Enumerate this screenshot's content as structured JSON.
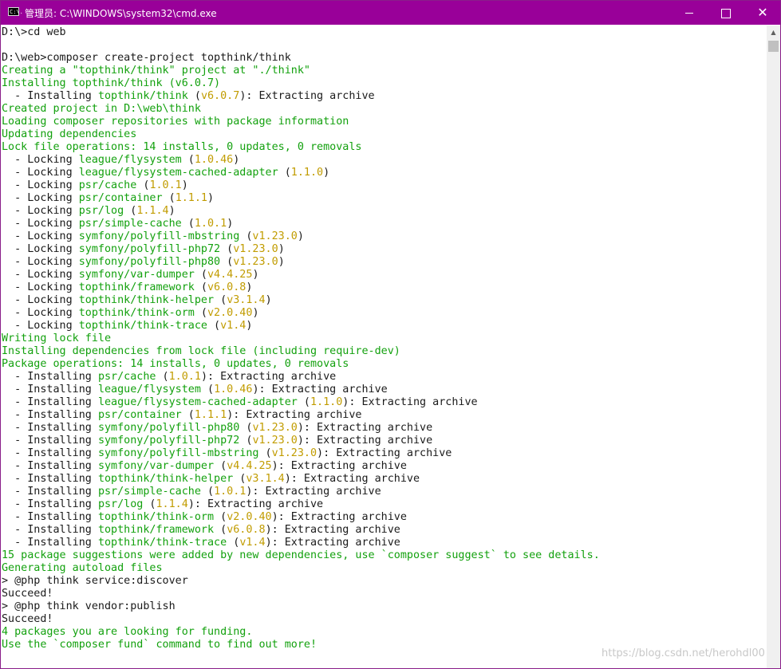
{
  "window": {
    "title": "管理员: C:\\WINDOWS\\system32\\cmd.exe",
    "icon": "console-icon",
    "icon_text": "C:\\.",
    "controls": {
      "minimize": "minimize-icon",
      "maximize": "maximize-icon",
      "close": "close-icon",
      "close_glyph": "✕"
    }
  },
  "colors": {
    "titlebar": "#990099",
    "green": "#13a10e",
    "yellow": "#c19c00",
    "text": "#1a1a1a"
  },
  "scrollbar": {
    "up_arrow": "▲"
  },
  "watermark": "https://blog.csdn.net/herohdl00",
  "lines": [
    [
      {
        "t": "D:\\>cd web",
        "c": "w"
      }
    ],
    [],
    [
      {
        "t": "D:\\web>composer create-project topthink/think",
        "c": "w"
      }
    ],
    [
      {
        "t": "Creating a \"topthink/think\" project at \"./think\"",
        "c": "g"
      }
    ],
    [
      {
        "t": "Installing topthink/think (v6.0.7)",
        "c": "g"
      }
    ],
    [
      {
        "t": "  - Installing ",
        "c": "w"
      },
      {
        "t": "topthink/think",
        "c": "g"
      },
      {
        "t": " (",
        "c": "w"
      },
      {
        "t": "v6.0.7",
        "c": "y"
      },
      {
        "t": "): Extracting archive",
        "c": "w"
      }
    ],
    [
      {
        "t": "Created project in D:\\web\\think",
        "c": "g"
      }
    ],
    [
      {
        "t": "Loading composer repositories with package information",
        "c": "g"
      }
    ],
    [
      {
        "t": "Updating dependencies",
        "c": "g"
      }
    ],
    [
      {
        "t": "Lock file operations: 14 installs, 0 updates, 0 removals",
        "c": "g"
      }
    ],
    [
      {
        "t": "  - Locking ",
        "c": "w"
      },
      {
        "t": "league/flysystem",
        "c": "g"
      },
      {
        "t": " (",
        "c": "w"
      },
      {
        "t": "1.0.46",
        "c": "y"
      },
      {
        "t": ")",
        "c": "w"
      }
    ],
    [
      {
        "t": "  - Locking ",
        "c": "w"
      },
      {
        "t": "league/flysystem-cached-adapter",
        "c": "g"
      },
      {
        "t": " (",
        "c": "w"
      },
      {
        "t": "1.1.0",
        "c": "y"
      },
      {
        "t": ")",
        "c": "w"
      }
    ],
    [
      {
        "t": "  - Locking ",
        "c": "w"
      },
      {
        "t": "psr/cache",
        "c": "g"
      },
      {
        "t": " (",
        "c": "w"
      },
      {
        "t": "1.0.1",
        "c": "y"
      },
      {
        "t": ")",
        "c": "w"
      }
    ],
    [
      {
        "t": "  - Locking ",
        "c": "w"
      },
      {
        "t": "psr/container",
        "c": "g"
      },
      {
        "t": " (",
        "c": "w"
      },
      {
        "t": "1.1.1",
        "c": "y"
      },
      {
        "t": ")",
        "c": "w"
      }
    ],
    [
      {
        "t": "  - Locking ",
        "c": "w"
      },
      {
        "t": "psr/log",
        "c": "g"
      },
      {
        "t": " (",
        "c": "w"
      },
      {
        "t": "1.1.4",
        "c": "y"
      },
      {
        "t": ")",
        "c": "w"
      }
    ],
    [
      {
        "t": "  - Locking ",
        "c": "w"
      },
      {
        "t": "psr/simple-cache",
        "c": "g"
      },
      {
        "t": " (",
        "c": "w"
      },
      {
        "t": "1.0.1",
        "c": "y"
      },
      {
        "t": ")",
        "c": "w"
      }
    ],
    [
      {
        "t": "  - Locking ",
        "c": "w"
      },
      {
        "t": "symfony/polyfill-mbstring",
        "c": "g"
      },
      {
        "t": " (",
        "c": "w"
      },
      {
        "t": "v1.23.0",
        "c": "y"
      },
      {
        "t": ")",
        "c": "w"
      }
    ],
    [
      {
        "t": "  - Locking ",
        "c": "w"
      },
      {
        "t": "symfony/polyfill-php72",
        "c": "g"
      },
      {
        "t": " (",
        "c": "w"
      },
      {
        "t": "v1.23.0",
        "c": "y"
      },
      {
        "t": ")",
        "c": "w"
      }
    ],
    [
      {
        "t": "  - Locking ",
        "c": "w"
      },
      {
        "t": "symfony/polyfill-php80",
        "c": "g"
      },
      {
        "t": " (",
        "c": "w"
      },
      {
        "t": "v1.23.0",
        "c": "y"
      },
      {
        "t": ")",
        "c": "w"
      }
    ],
    [
      {
        "t": "  - Locking ",
        "c": "w"
      },
      {
        "t": "symfony/var-dumper",
        "c": "g"
      },
      {
        "t": " (",
        "c": "w"
      },
      {
        "t": "v4.4.25",
        "c": "y"
      },
      {
        "t": ")",
        "c": "w"
      }
    ],
    [
      {
        "t": "  - Locking ",
        "c": "w"
      },
      {
        "t": "topthink/framework",
        "c": "g"
      },
      {
        "t": " (",
        "c": "w"
      },
      {
        "t": "v6.0.8",
        "c": "y"
      },
      {
        "t": ")",
        "c": "w"
      }
    ],
    [
      {
        "t": "  - Locking ",
        "c": "w"
      },
      {
        "t": "topthink/think-helper",
        "c": "g"
      },
      {
        "t": " (",
        "c": "w"
      },
      {
        "t": "v3.1.4",
        "c": "y"
      },
      {
        "t": ")",
        "c": "w"
      }
    ],
    [
      {
        "t": "  - Locking ",
        "c": "w"
      },
      {
        "t": "topthink/think-orm",
        "c": "g"
      },
      {
        "t": " (",
        "c": "w"
      },
      {
        "t": "v2.0.40",
        "c": "y"
      },
      {
        "t": ")",
        "c": "w"
      }
    ],
    [
      {
        "t": "  - Locking ",
        "c": "w"
      },
      {
        "t": "topthink/think-trace",
        "c": "g"
      },
      {
        "t": " (",
        "c": "w"
      },
      {
        "t": "v1.4",
        "c": "y"
      },
      {
        "t": ")",
        "c": "w"
      }
    ],
    [
      {
        "t": "Writing lock file",
        "c": "g"
      }
    ],
    [
      {
        "t": "Installing dependencies from lock file (including require-dev)",
        "c": "g"
      }
    ],
    [
      {
        "t": "Package operations: 14 installs, 0 updates, 0 removals",
        "c": "g"
      }
    ],
    [
      {
        "t": "  - Installing ",
        "c": "w"
      },
      {
        "t": "psr/cache",
        "c": "g"
      },
      {
        "t": " (",
        "c": "w"
      },
      {
        "t": "1.0.1",
        "c": "y"
      },
      {
        "t": "): Extracting archive",
        "c": "w"
      }
    ],
    [
      {
        "t": "  - Installing ",
        "c": "w"
      },
      {
        "t": "league/flysystem",
        "c": "g"
      },
      {
        "t": " (",
        "c": "w"
      },
      {
        "t": "1.0.46",
        "c": "y"
      },
      {
        "t": "): Extracting archive",
        "c": "w"
      }
    ],
    [
      {
        "t": "  - Installing ",
        "c": "w"
      },
      {
        "t": "league/flysystem-cached-adapter",
        "c": "g"
      },
      {
        "t": " (",
        "c": "w"
      },
      {
        "t": "1.1.0",
        "c": "y"
      },
      {
        "t": "): Extracting archive",
        "c": "w"
      }
    ],
    [
      {
        "t": "  - Installing ",
        "c": "w"
      },
      {
        "t": "psr/container",
        "c": "g"
      },
      {
        "t": " (",
        "c": "w"
      },
      {
        "t": "1.1.1",
        "c": "y"
      },
      {
        "t": "): Extracting archive",
        "c": "w"
      }
    ],
    [
      {
        "t": "  - Installing ",
        "c": "w"
      },
      {
        "t": "symfony/polyfill-php80",
        "c": "g"
      },
      {
        "t": " (",
        "c": "w"
      },
      {
        "t": "v1.23.0",
        "c": "y"
      },
      {
        "t": "): Extracting archive",
        "c": "w"
      }
    ],
    [
      {
        "t": "  - Installing ",
        "c": "w"
      },
      {
        "t": "symfony/polyfill-php72",
        "c": "g"
      },
      {
        "t": " (",
        "c": "w"
      },
      {
        "t": "v1.23.0",
        "c": "y"
      },
      {
        "t": "): Extracting archive",
        "c": "w"
      }
    ],
    [
      {
        "t": "  - Installing ",
        "c": "w"
      },
      {
        "t": "symfony/polyfill-mbstring",
        "c": "g"
      },
      {
        "t": " (",
        "c": "w"
      },
      {
        "t": "v1.23.0",
        "c": "y"
      },
      {
        "t": "): Extracting archive",
        "c": "w"
      }
    ],
    [
      {
        "t": "  - Installing ",
        "c": "w"
      },
      {
        "t": "symfony/var-dumper",
        "c": "g"
      },
      {
        "t": " (",
        "c": "w"
      },
      {
        "t": "v4.4.25",
        "c": "y"
      },
      {
        "t": "): Extracting archive",
        "c": "w"
      }
    ],
    [
      {
        "t": "  - Installing ",
        "c": "w"
      },
      {
        "t": "topthink/think-helper",
        "c": "g"
      },
      {
        "t": " (",
        "c": "w"
      },
      {
        "t": "v3.1.4",
        "c": "y"
      },
      {
        "t": "): Extracting archive",
        "c": "w"
      }
    ],
    [
      {
        "t": "  - Installing ",
        "c": "w"
      },
      {
        "t": "psr/simple-cache",
        "c": "g"
      },
      {
        "t": " (",
        "c": "w"
      },
      {
        "t": "1.0.1",
        "c": "y"
      },
      {
        "t": "): Extracting archive",
        "c": "w"
      }
    ],
    [
      {
        "t": "  - Installing ",
        "c": "w"
      },
      {
        "t": "psr/log",
        "c": "g"
      },
      {
        "t": " (",
        "c": "w"
      },
      {
        "t": "1.1.4",
        "c": "y"
      },
      {
        "t": "): Extracting archive",
        "c": "w"
      }
    ],
    [
      {
        "t": "  - Installing ",
        "c": "w"
      },
      {
        "t": "topthink/think-orm",
        "c": "g"
      },
      {
        "t": " (",
        "c": "w"
      },
      {
        "t": "v2.0.40",
        "c": "y"
      },
      {
        "t": "): Extracting archive",
        "c": "w"
      }
    ],
    [
      {
        "t": "  - Installing ",
        "c": "w"
      },
      {
        "t": "topthink/framework",
        "c": "g"
      },
      {
        "t": " (",
        "c": "w"
      },
      {
        "t": "v6.0.8",
        "c": "y"
      },
      {
        "t": "): Extracting archive",
        "c": "w"
      }
    ],
    [
      {
        "t": "  - Installing ",
        "c": "w"
      },
      {
        "t": "topthink/think-trace",
        "c": "g"
      },
      {
        "t": " (",
        "c": "w"
      },
      {
        "t": "v1.4",
        "c": "y"
      },
      {
        "t": "): Extracting archive",
        "c": "w"
      }
    ],
    [
      {
        "t": "15 package suggestions were added by new dependencies, use `composer suggest` to see details.",
        "c": "g"
      }
    ],
    [
      {
        "t": "Generating autoload files",
        "c": "g"
      }
    ],
    [
      {
        "t": "> @php think service:discover",
        "c": "w"
      }
    ],
    [
      {
        "t": "Succeed!",
        "c": "w"
      }
    ],
    [
      {
        "t": "> @php think vendor:publish",
        "c": "w"
      }
    ],
    [
      {
        "t": "Succeed!",
        "c": "w"
      }
    ],
    [
      {
        "t": "4 packages you are looking for funding.",
        "c": "g"
      }
    ],
    [
      {
        "t": "Use the `composer fund` command to find out more!",
        "c": "g"
      }
    ]
  ]
}
